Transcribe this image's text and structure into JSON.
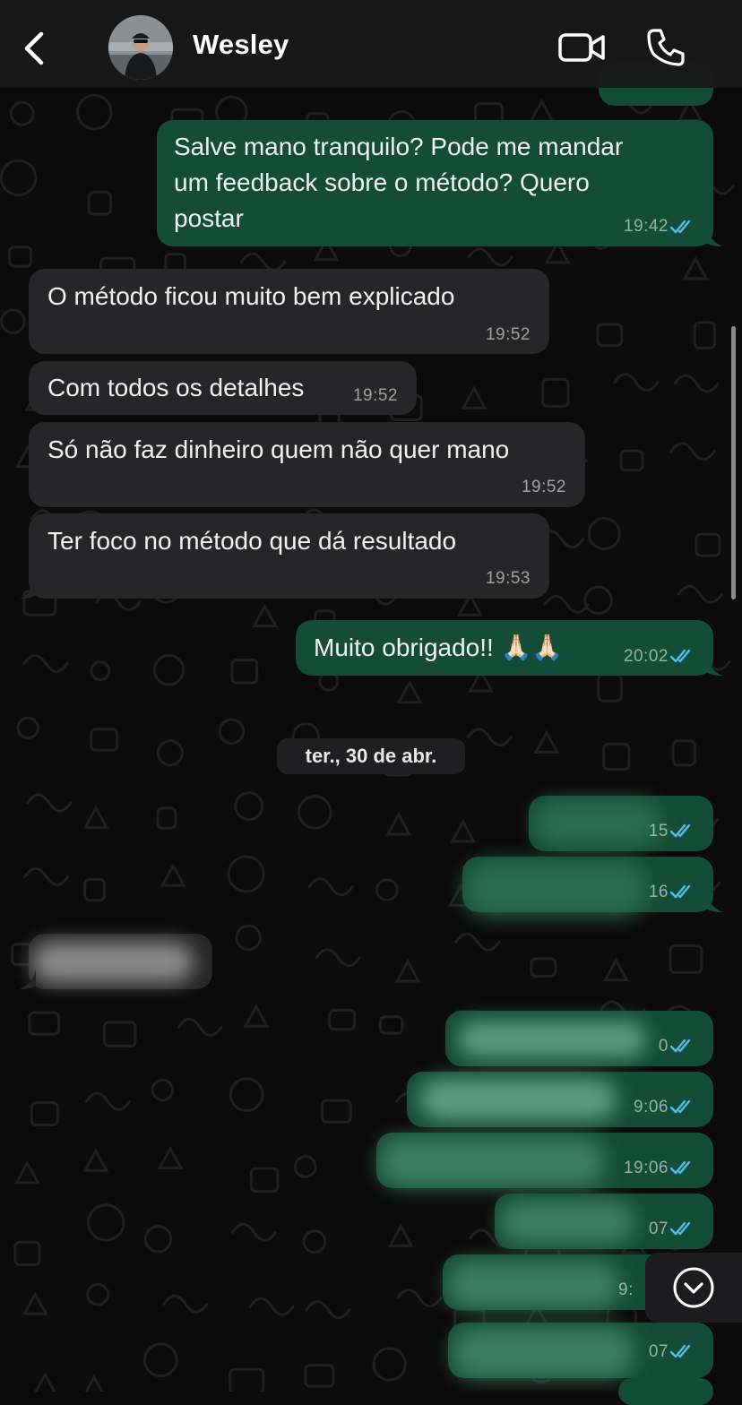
{
  "contact": {
    "name": "Wesley"
  },
  "messages": [
    {
      "dir": "out",
      "text": "Salve mano tranquilo? Pode me mandar\num feedback sobre o método? Quero\npostar",
      "time": "19:42",
      "read": true
    },
    {
      "dir": "in",
      "text": "O método ficou muito bem explicado",
      "time": "19:52"
    },
    {
      "dir": "in",
      "text": "Com todos os detalhes",
      "time": "19:52"
    },
    {
      "dir": "in",
      "text": "Só não faz dinheiro quem não quer mano",
      "time": "19:52"
    },
    {
      "dir": "in",
      "text": "Ter foco no método que dá resultado",
      "time": "19:53"
    },
    {
      "dir": "out",
      "text": "Muito obrigado!! 🙏🏻🙏🏻",
      "time": "20:02",
      "read": true
    }
  ],
  "date_separator": "ter., 30 de abr.",
  "blurred_messages": [
    {
      "dir": "out",
      "time_fragment": "15",
      "read": true
    },
    {
      "dir": "out",
      "time_fragment": "16",
      "read": true
    },
    {
      "dir": "in",
      "time_fragment": ""
    },
    {
      "dir": "out",
      "time_fragment": "0",
      "read": true
    },
    {
      "dir": "out",
      "time_fragment": "9:06",
      "read": true
    },
    {
      "dir": "out",
      "time_fragment": "19:06",
      "read": true
    },
    {
      "dir": "out",
      "time_fragment": "07",
      "read": true
    },
    {
      "dir": "out",
      "time_fragment": "9:",
      "read": false
    },
    {
      "dir": "out",
      "time_fragment": "07",
      "read": true
    }
  ],
  "icons": {
    "back": "chevron-left-icon",
    "video": "video-camera-icon",
    "phone": "phone-icon",
    "scroll_down": "chevron-down-circle-icon",
    "read_receipt": "double-check-icon"
  },
  "colors": {
    "outgoing_bubble": "#144d37",
    "incoming_bubble": "#262628",
    "read_ticks": "#53bdeb",
    "background": "#0b0b0b"
  }
}
